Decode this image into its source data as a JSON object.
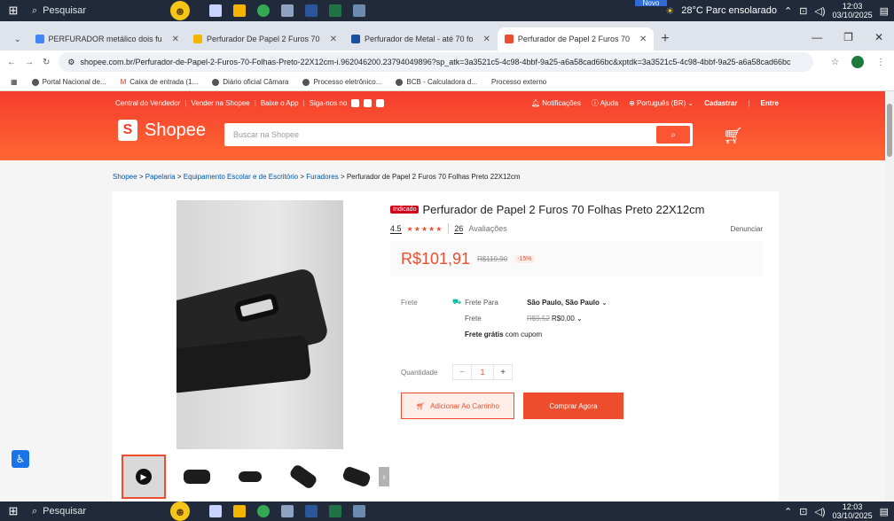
{
  "os": {
    "search_placeholder": "Pesquisar",
    "weather": "28°C  Parc ensolarado",
    "time": "12:03",
    "date": "03/10/2025",
    "novo_label": "Novo"
  },
  "browser": {
    "tabs": [
      {
        "label": "PERFURADOR metálico dois fu",
        "fav_color": "#4285f4"
      },
      {
        "label": "Perfurador De Papel 2 Furos 70",
        "fav_color": "#f5b400"
      },
      {
        "label": "Perfurador de Metal - até 70 fo",
        "fav_color": "#1a4fa0"
      },
      {
        "label": "Perfurador de Papel 2 Furos 70",
        "fav_color": "#ee4d2d"
      }
    ],
    "new_tab": "+",
    "url": "shopee.com.br/Perfurador-de-Papel-2-Furos-70-Folhas-Preto-22X12cm-i.962046200.23794049896?sp_atk=3a3521c5-4c98-4bbf-9a25-a6a58cad66bc&xptdk=3a3521c5-4c98-4bbf-9a25-a6a58cad66bc",
    "bookmarks": [
      "Portal Nacional de...",
      "Caixa de entrada (1...",
      "Diário oficial Câmara",
      "Processo eletrônico...",
      "BCB - Calculadora d...",
      "Processo externo"
    ]
  },
  "shopee": {
    "topnav_left": [
      "Central do Vendedor",
      "Vender na Shopee",
      "Baixe o App",
      "Siga-nos no"
    ],
    "notifications": "Notificações",
    "help": "Ajuda",
    "language": "Português (BR)",
    "register": "Cadastrar",
    "login": "Entre",
    "logo": "Shopee",
    "search_placeholder": "Buscar na Shopee"
  },
  "breadcrumb": {
    "items": [
      "Shopee",
      "Papelaria",
      "Equipamento Escolar e de Escritório",
      "Furadores"
    ],
    "sep": ">",
    "current": "Perfurador de Papel 2 Furos 70 Folhas Preto 22X12cm"
  },
  "product": {
    "badge": "Indicado",
    "title": "Perfurador de Papel 2 Furos 70 Folhas Preto 22X12cm",
    "rating": "4.5",
    "stars": "★★★★★",
    "reviews_count": "26",
    "reviews_label": "Avaliações",
    "report": "Denunciar",
    "price": "R$101,91",
    "old_price": "R$119,90",
    "discount": "-15%",
    "shipping_label": "Frete",
    "shipping_to_label": "Frete Para",
    "shipping_to_value": "São Paulo, São Paulo",
    "shipping_cost_label": "Frete",
    "shipping_old": "R$9,52",
    "shipping_new": "R$0,00",
    "free_shipping_bold": "Frete grátis",
    "free_shipping_rest": " com cupom",
    "quantity_label": "Quantidade",
    "quantity": "1",
    "add_to_cart": "Adicionar Ao Carrinho",
    "buy_now": "Comprar Agora"
  }
}
